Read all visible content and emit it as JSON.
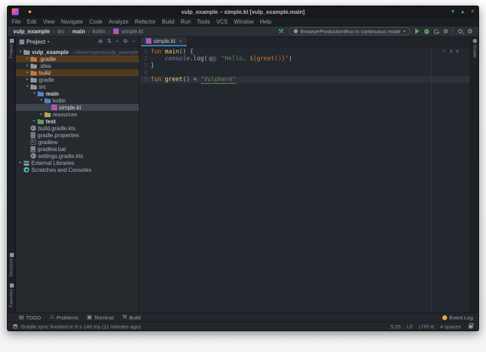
{
  "window": {
    "title": "vulp_example – simple.kt [vulp_example.main]",
    "controls": {
      "minimize": "▾",
      "maximize": "▴",
      "close": "×"
    }
  },
  "menu": {
    "items": [
      "File",
      "Edit",
      "View",
      "Navigate",
      "Code",
      "Analyze",
      "Refactor",
      "Build",
      "Run",
      "Tools",
      "VCS",
      "Window",
      "Help"
    ]
  },
  "navbar": {
    "breadcrumbs": [
      {
        "label": "vulp_example",
        "bold": true
      },
      {
        "label": "src",
        "bold": false
      },
      {
        "label": "main",
        "bold": true
      },
      {
        "label": "kotlin",
        "bold": false
      },
      {
        "label": "simple.kt",
        "bold": false,
        "icon": "kotlin-file-icon"
      }
    ],
    "run_config": "BrowserProductionRun in continuous mode",
    "icons": [
      "build-hammer-icon",
      "run-icon",
      "debug-icon",
      "profiler-icon",
      "stop-icon",
      "search-icon",
      "settings-gear-icon"
    ]
  },
  "project_panel": {
    "header_label": "Project",
    "header_tools": [
      {
        "name": "select-opened-file-button",
        "glyph": "⊗"
      },
      {
        "name": "expand-all-button",
        "glyph": "⇅"
      },
      {
        "name": "collapse-all-button",
        "glyph": "÷"
      },
      {
        "name": "settings-gear-icon",
        "glyph": "⚙"
      },
      {
        "name": "hide-panel-button",
        "glyph": "−"
      }
    ],
    "tree": [
      {
        "label": "vulp_example",
        "suffix": "~/IdeaProjects/vulp_example",
        "indent": 0,
        "arrow": "down",
        "icon": "project-folder",
        "bold": true
      },
      {
        "label": ".gradle",
        "indent": 1,
        "arrow": "right",
        "icon": "folder-excluded",
        "row": "excluded"
      },
      {
        "label": ".idea",
        "indent": 1,
        "arrow": "right",
        "icon": "folder"
      },
      {
        "label": "build",
        "indent": 1,
        "arrow": "right",
        "icon": "folder-excluded",
        "row": "excluded"
      },
      {
        "label": "gradle",
        "indent": 1,
        "arrow": "right",
        "icon": "folder"
      },
      {
        "label": "src",
        "indent": 1,
        "arrow": "down",
        "icon": "folder"
      },
      {
        "label": "main",
        "indent": 2,
        "arrow": "down",
        "icon": "folder-src",
        "bold": true
      },
      {
        "label": "kotlin",
        "indent": 3,
        "arrow": "down",
        "icon": "folder-src"
      },
      {
        "label": "simple.kt",
        "indent": 4,
        "icon": "kotlin-file",
        "row": "selected"
      },
      {
        "label": "resources",
        "indent": 3,
        "arrow": "right",
        "icon": "folder-res"
      },
      {
        "label": "test",
        "indent": 2,
        "arrow": "right",
        "icon": "folder-test",
        "bold": true
      },
      {
        "label": "build.gradle.kts",
        "indent": 1,
        "icon": "gradle-file"
      },
      {
        "label": "gradle.properties",
        "indent": 1,
        "icon": "props-file"
      },
      {
        "label": "gradlew",
        "indent": 1,
        "icon": "shell-file"
      },
      {
        "label": "gradlew.bat",
        "indent": 1,
        "icon": "bat-file"
      },
      {
        "label": "settings.gradle.kts",
        "indent": 1,
        "icon": "gradle-file"
      },
      {
        "label": "External Libraries",
        "indent": 0,
        "arrow": "right",
        "icon": "libs"
      },
      {
        "label": "Scratches and Consoles",
        "indent": 0,
        "icon": "scratches"
      }
    ]
  },
  "editor": {
    "tab_label": "simple.kt",
    "lines": [
      {
        "n": "1",
        "segs": [
          {
            "t": "fun ",
            "c": "kw"
          },
          {
            "t": "main",
            "c": "fn"
          },
          {
            "t": "() {",
            "c": "txt"
          }
        ]
      },
      {
        "n": "2",
        "segs": [
          {
            "t": "    ",
            "c": "txt"
          },
          {
            "t": "console",
            "c": "prop"
          },
          {
            "t": ".log(",
            "c": "txt"
          },
          {
            "t": "s:",
            "c": "hint"
          },
          {
            "t": " ",
            "c": "txt"
          },
          {
            "t": "\"Hello, ",
            "c": "str"
          },
          {
            "t": "${greet()}",
            "c": "tpl"
          },
          {
            "t": "\"",
            "c": "str"
          },
          {
            "t": ")",
            "c": "txt"
          }
        ]
      },
      {
        "n": "3",
        "segs": [
          {
            "t": "}",
            "c": "txt"
          }
        ]
      },
      {
        "n": "4",
        "segs": []
      },
      {
        "n": "5",
        "caret": true,
        "segs": [
          {
            "t": "fun ",
            "c": "kw"
          },
          {
            "t": "greet",
            "c": "fn"
          },
          {
            "t": "() = ",
            "c": "txt"
          },
          {
            "t": "\"Vulphere\"",
            "c": "stru"
          }
        ]
      }
    ],
    "inspection": {
      "ok_glyph": "✓",
      "up_glyph": "∧",
      "down_glyph": "∨"
    }
  },
  "stripes": {
    "project": "Project",
    "structure": "Structure",
    "favorites": "Favorites",
    "gradle": "Gradle"
  },
  "bottom_bar": {
    "items": [
      {
        "icon": "todo-icon",
        "glyph": "▤",
        "label": "TODO"
      },
      {
        "icon": "problems-icon",
        "glyph": "⚠",
        "label": "Problems"
      },
      {
        "icon": "terminal-icon",
        "glyph": "▣",
        "label": "Terminal"
      },
      {
        "icon": "build-hammer-icon",
        "glyph": "⚒",
        "label": "Build"
      }
    ],
    "event_log_label": "Event Log"
  },
  "status_bar": {
    "message": "Gradle sync finished in 6 s 140 ms (11 minutes ago)",
    "items": [
      "5:25",
      "LF",
      "UTF-8",
      "4 spaces"
    ]
  },
  "colors": {
    "accent_blue": "#3b82c4",
    "run_green": "#5aa85f",
    "close_red": "#e0574e",
    "teal": "#45b3a2",
    "excluded_row": "#52391f",
    "selection_row": "#3f454c",
    "keyword": "#cc7832",
    "function": "#ffc66b",
    "string": "#6a8759",
    "property": "#9876aa",
    "event_log_badge": "#e8a33d"
  }
}
